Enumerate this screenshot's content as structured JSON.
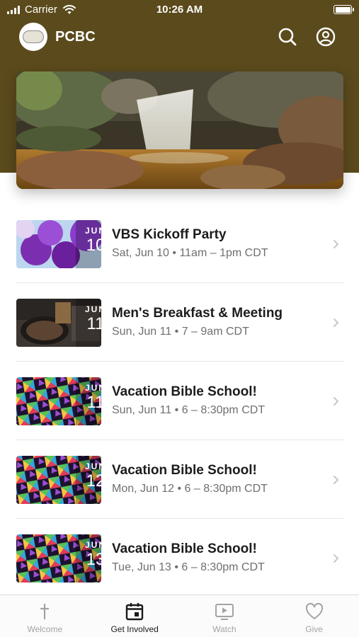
{
  "status_bar": {
    "carrier": "Carrier",
    "time": "10:26 AM"
  },
  "app": {
    "title": "PCBC"
  },
  "colors": {
    "header": "#5b4a1c",
    "active_tab": "#1a1a1a",
    "inactive_tab": "#a3a3a3"
  },
  "events": [
    {
      "title": "VBS Kickoff Party",
      "subtitle": "Sat, Jun 10 • 11am – 1pm CDT",
      "month": "JUN",
      "day": "10",
      "thumb": "balloons"
    },
    {
      "title": "Men's Breakfast & Meeting",
      "subtitle": "Sun, Jun 11 • 7 – 9am CDT",
      "month": "JUN",
      "day": "11",
      "thumb": "coffee"
    },
    {
      "title": "Vacation Bible School!",
      "subtitle": "Sun, Jun 11 • 6 – 8:30pm CDT",
      "month": "JUN",
      "day": "11",
      "thumb": "colorful-pattern"
    },
    {
      "title": "Vacation Bible School!",
      "subtitle": "Mon, Jun 12 • 6 – 8:30pm CDT",
      "month": "JUN",
      "day": "12",
      "thumb": "colorful-pattern"
    },
    {
      "title": "Vacation Bible School!",
      "subtitle": "Tue, Jun 13 • 6 – 8:30pm CDT",
      "month": "JUN",
      "day": "13",
      "thumb": "colorful-pattern"
    }
  ],
  "tabs": [
    {
      "label": "Welcome",
      "icon": "cross-icon",
      "active": false
    },
    {
      "label": "Get Involved",
      "icon": "calendar-icon",
      "active": true
    },
    {
      "label": "Watch",
      "icon": "tv-play-icon",
      "active": false
    },
    {
      "label": "Give",
      "icon": "heart-icon",
      "active": false
    }
  ]
}
